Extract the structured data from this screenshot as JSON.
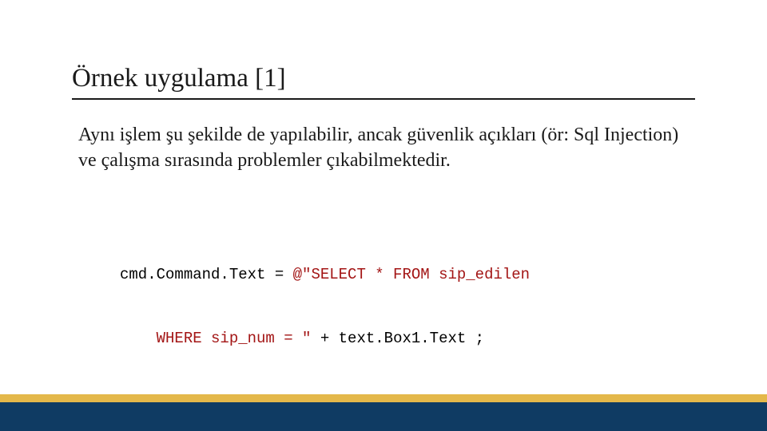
{
  "title": "Örnek uygulama [1]",
  "body": "Aynı işlem şu şekilde de yapılabilir, ancak güvenlik açıkları (ör: Sql Injection) ve çalışma sırasında problemler çıkabilmektedir.",
  "code": {
    "line1": {
      "p1": "cmd.Command.Text = ",
      "p2": "@\"SELECT * FROM sip_edilen"
    },
    "line2": {
      "p1": "    WHERE sip_num = \"",
      "p2": " + text.Box1.Text ;"
    }
  },
  "colors": {
    "gold": "#e4b84a",
    "navy": "#0f3b63",
    "string": "#a31515"
  }
}
